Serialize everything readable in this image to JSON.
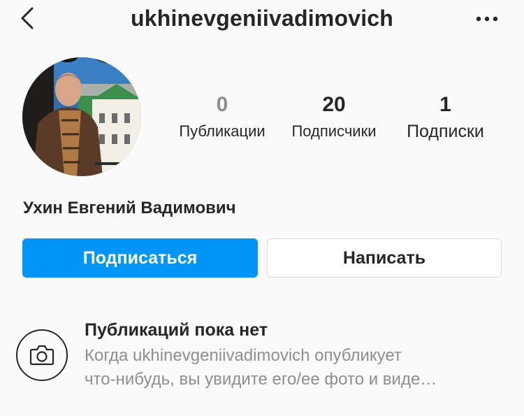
{
  "header": {
    "username": "ukhinevgeniivadimovich",
    "back_icon": "chevron-left-icon",
    "more_icon": "more-horizontal-icon"
  },
  "profile": {
    "avatar_icon": "profile-photo",
    "full_name": "Ухин Евгений Вадимович",
    "stats": {
      "posts": {
        "value": "0",
        "label": "Публикации"
      },
      "followers": {
        "value": "20",
        "label": "Подписчики"
      },
      "following": {
        "value": "1",
        "label": "Подписки"
      }
    }
  },
  "actions": {
    "follow_label": "Подписаться",
    "message_label": "Написать"
  },
  "empty_state": {
    "icon": "camera-icon",
    "title": "Публикаций пока нет",
    "line1": "Когда ukhinevgeniivadimovich опубликует",
    "line2": "что-нибудь, вы увидите его/ее фото и виде…"
  },
  "colors": {
    "accent": "#0095f6",
    "background": "#fafafa",
    "text": "#262626",
    "secondary_text": "#8e8e8e"
  }
}
